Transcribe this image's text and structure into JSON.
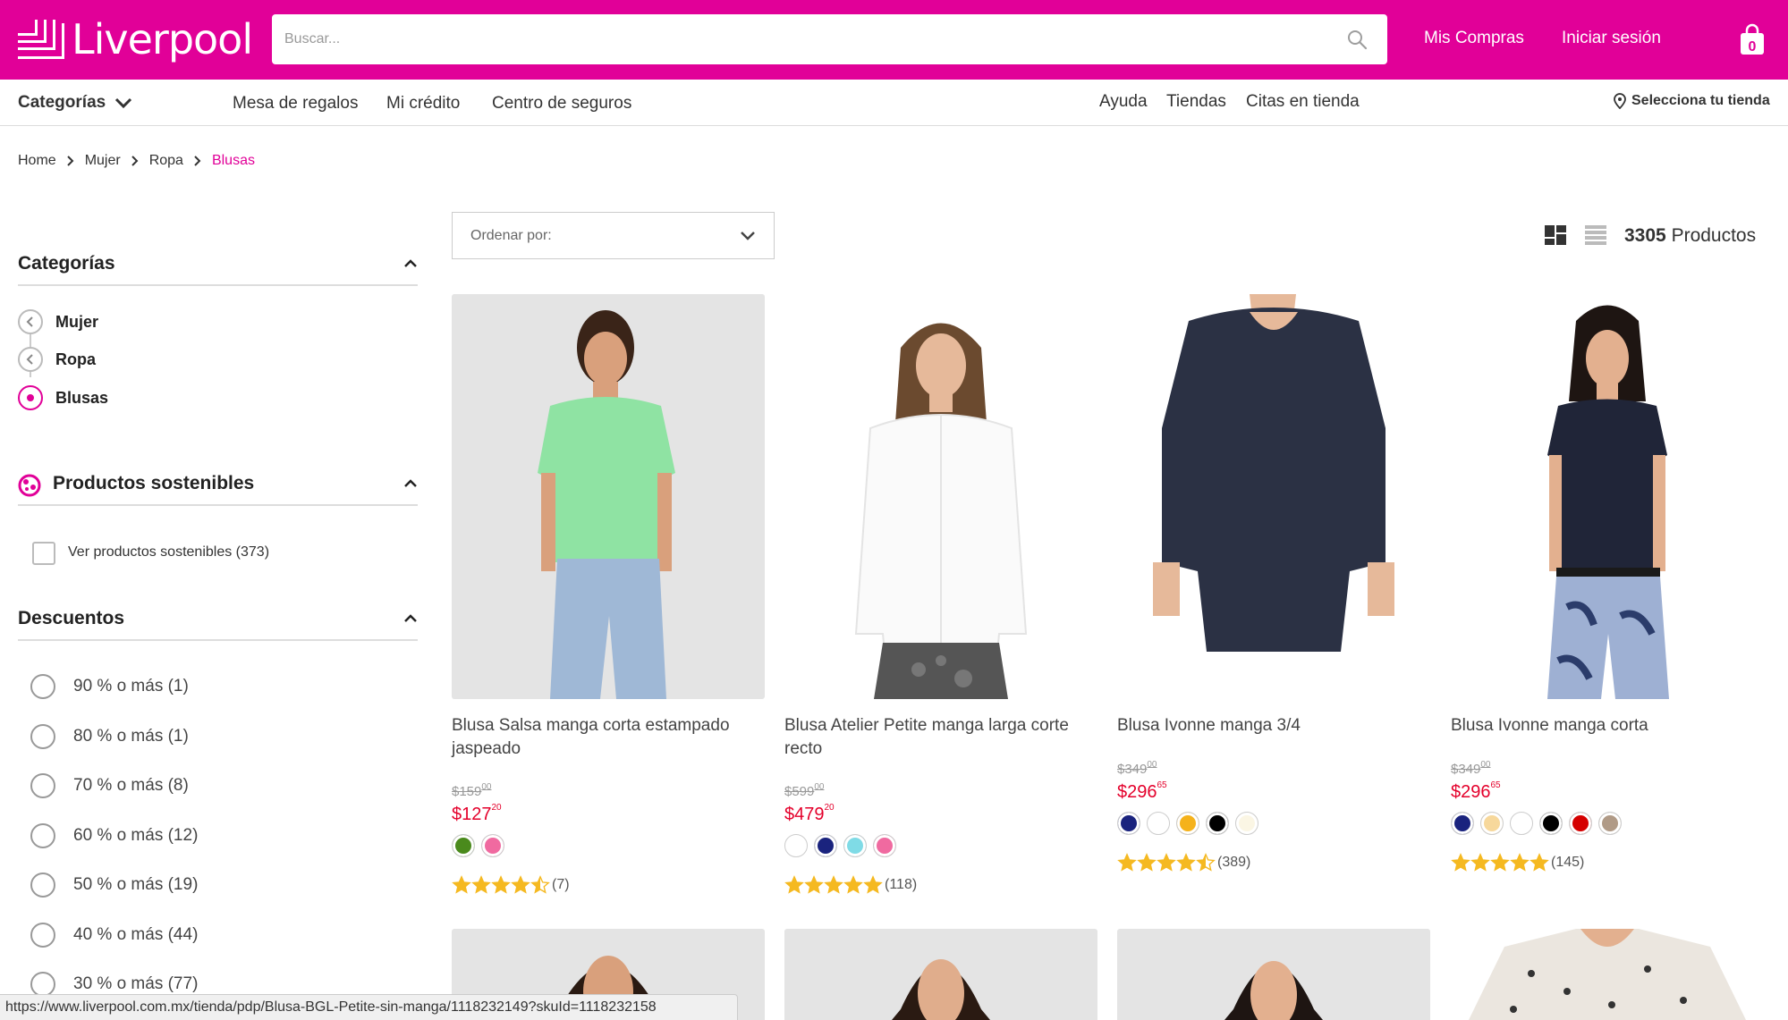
{
  "header": {
    "brand": "Liverpool",
    "search_placeholder": "Buscar...",
    "my_purchases": "Mis Compras",
    "login": "Iniciar sesión",
    "cart_count": "0"
  },
  "nav": {
    "categories": "Categorías",
    "links": [
      "Mesa de regalos",
      "Mi crédito",
      "Centro de seguros"
    ],
    "right_links": [
      "Ayuda",
      "Tiendas",
      "Citas en tienda"
    ],
    "store_selector": "Selecciona tu tienda"
  },
  "breadcrumb": [
    "Home",
    "Mujer",
    "Ropa",
    "Blusas"
  ],
  "sidebar": {
    "categories_title": "Categorías",
    "categories": [
      "Mujer",
      "Ropa",
      "Blusas"
    ],
    "sustainable_title": "Productos sostenibles",
    "sustainable_checkbox": "Ver productos sostenibles (373)",
    "discounts_title": "Descuentos",
    "discounts": [
      "90 % o más (1)",
      "80 % o más (1)",
      "70 % o más (8)",
      "60 % o más (12)",
      "50 % o más (19)",
      "40 % o más (44)",
      "30 % o más (77)"
    ]
  },
  "toolbar": {
    "sort_label": "Ordenar por:",
    "count_number": "3305",
    "count_label": "Productos"
  },
  "products": [
    {
      "name": "Blusa Salsa manga corta estampado jaspeado",
      "old_price": "$159",
      "old_cents": "00",
      "price": "$127",
      "cents": "20",
      "swatches": [
        "#4a8a1c",
        "#f06aa0"
      ],
      "rating": 4.5,
      "reviews": "(7)"
    },
    {
      "name": "Blusa Atelier Petite manga larga corte recto",
      "old_price": "$599",
      "old_cents": "00",
      "price": "$479",
      "cents": "20",
      "swatches": [
        "#ffffff",
        "#1a237e",
        "#7fdbe6",
        "#f06aa0"
      ],
      "rating": 5,
      "reviews": "(118)"
    },
    {
      "name": "Blusa Ivonne manga 3/4",
      "old_price": "$349",
      "old_cents": "00",
      "price": "$296",
      "cents": "65",
      "swatches": [
        "#1a237e",
        "#ffffff",
        "#f5b21b",
        "#000000",
        "#fbf6e4"
      ],
      "rating": 4.5,
      "reviews": "(389)"
    },
    {
      "name": "Blusa Ivonne manga corta",
      "old_price": "$349",
      "old_cents": "00",
      "price": "$296",
      "cents": "65",
      "swatches": [
        "#1a237e",
        "#f7d89b",
        "#ffffff",
        "#000000",
        "#d50000",
        "#b09a86"
      ],
      "rating": 5,
      "reviews": "(145)"
    }
  ],
  "status_url": "https://www.liverpool.com.mx/tienda/pdp/Blusa-BGL-Petite-sin-manga/1118232149?skuId=1118232158",
  "colors": {
    "brand": "#e10098",
    "sale": "#e4002b",
    "star": "#f5b921"
  }
}
